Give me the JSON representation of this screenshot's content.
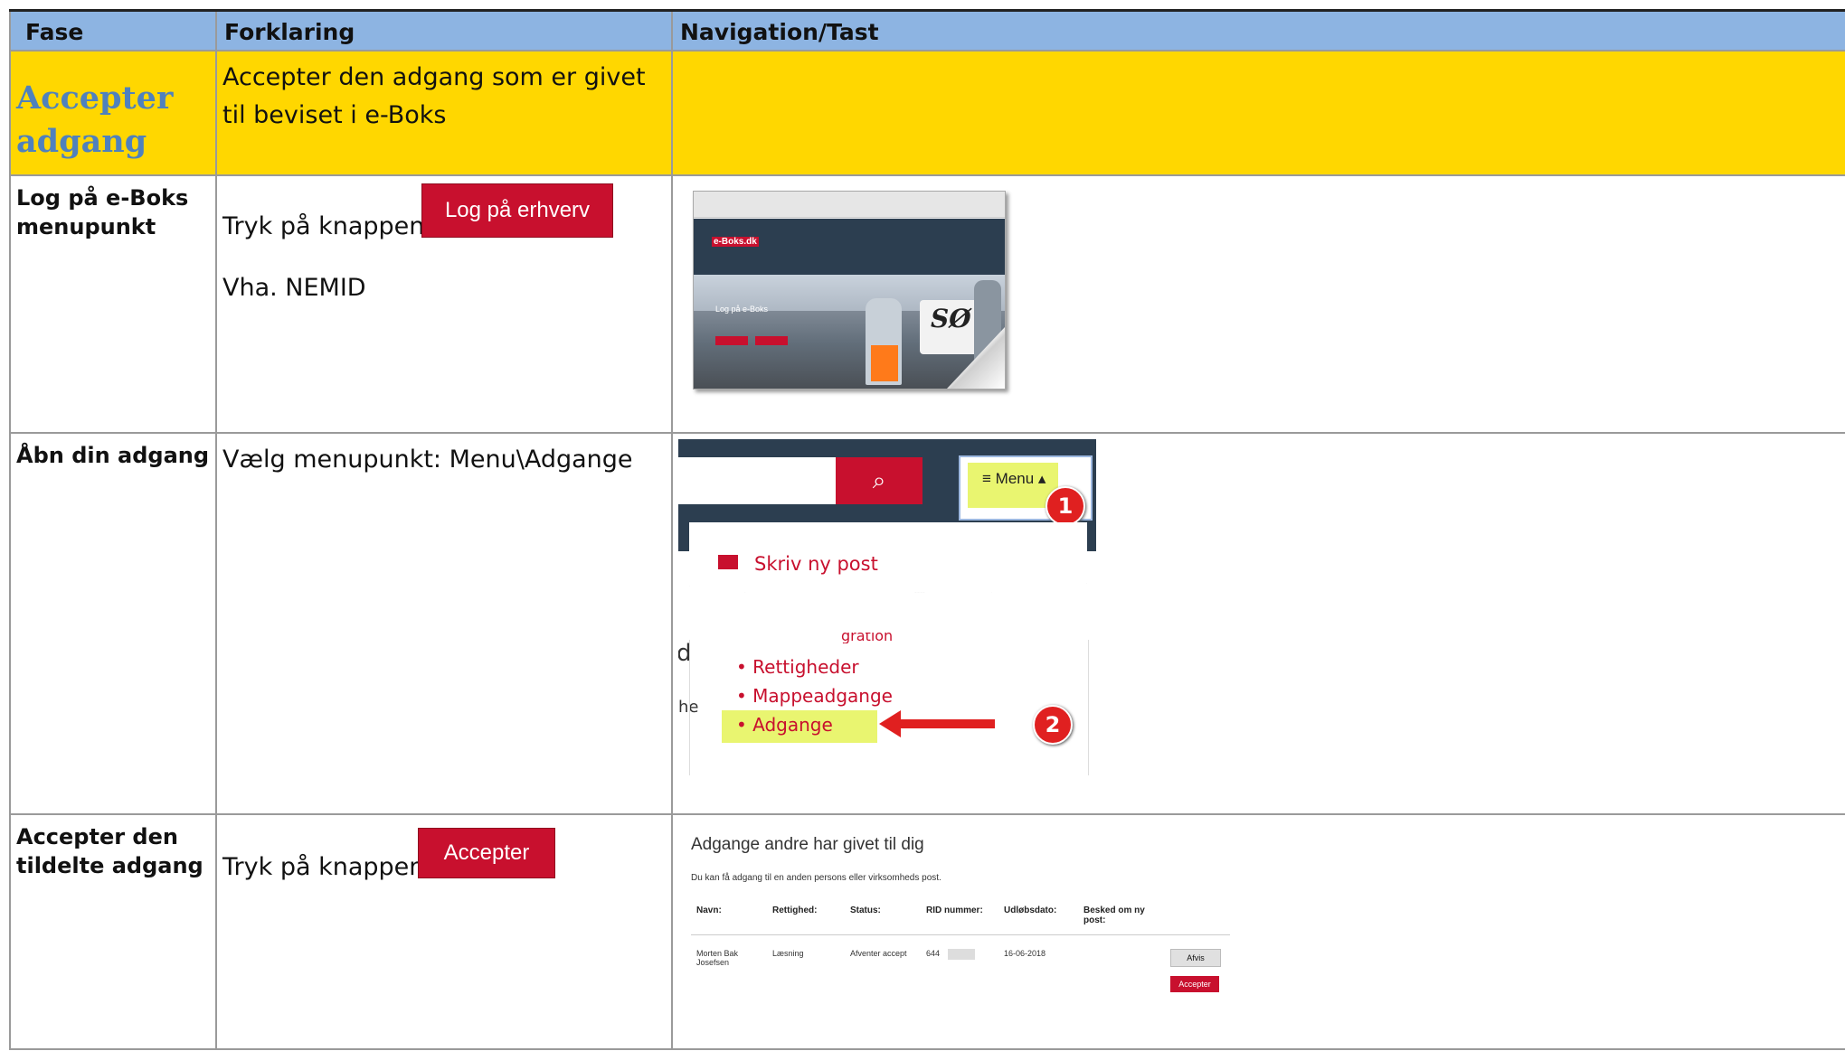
{
  "table": {
    "headers": [
      "Fase",
      "Forklaring",
      "Navigation/Tast"
    ],
    "phase_row": {
      "fase": "Accepter adgang",
      "forklaring": "Accepter den adgang som er givet til beviset i e-Boks"
    },
    "rows": [
      {
        "fase": "Log på e-Boks menupunkt",
        "forklaring_prefix": "Tryk på knappen:",
        "button_label": "Log på erhverv",
        "forklaring_extra": "Vha. NEMID"
      },
      {
        "fase": "Åbn din adgang",
        "forklaring": "Vælg menupunkt: Menu\\Adgange"
      },
      {
        "fase": "Accepter den tildelte adgang",
        "forklaring_prefix": "Tryk på knappen:",
        "button_label": "Accepter"
      }
    ]
  },
  "screenshot_eboks": {
    "logo": "e-Boks.dk",
    "hero_text": "Log på e-Boks",
    "boat_text": "SØ"
  },
  "screenshot_menu": {
    "menu_label": "Menu",
    "badge1": "1",
    "badge2": "2",
    "item_new": "Skriv ny post",
    "cut_text": "gration",
    "items": [
      "Rettigheder",
      "Mappeadgange",
      "Adgange"
    ],
    "frag_d": "d",
    "frag_he": "he"
  },
  "screenshot_adgange": {
    "title": "Adgange andre har givet til dig",
    "subtitle": "Du kan få adgang til en anden persons eller virksomheds post.",
    "columns": [
      "Navn:",
      "Rettighed:",
      "Status:",
      "RID nummer:",
      "Udløbsdato:",
      "Besked om ny post:"
    ],
    "row": {
      "navn": "Morten Bak Josefsen",
      "rettighed": "Læsning",
      "status": "Afventer accept",
      "rid": "644",
      "udlobsdato": "16-06-2018"
    },
    "btn_afvis": "Afvis",
    "btn_accept": "Accepter"
  },
  "colors": {
    "header_blue": "#8db4e2",
    "phase_yellow": "#ffd700",
    "phase_text_blue": "#4f81bd",
    "eboks_red": "#c8102e"
  }
}
